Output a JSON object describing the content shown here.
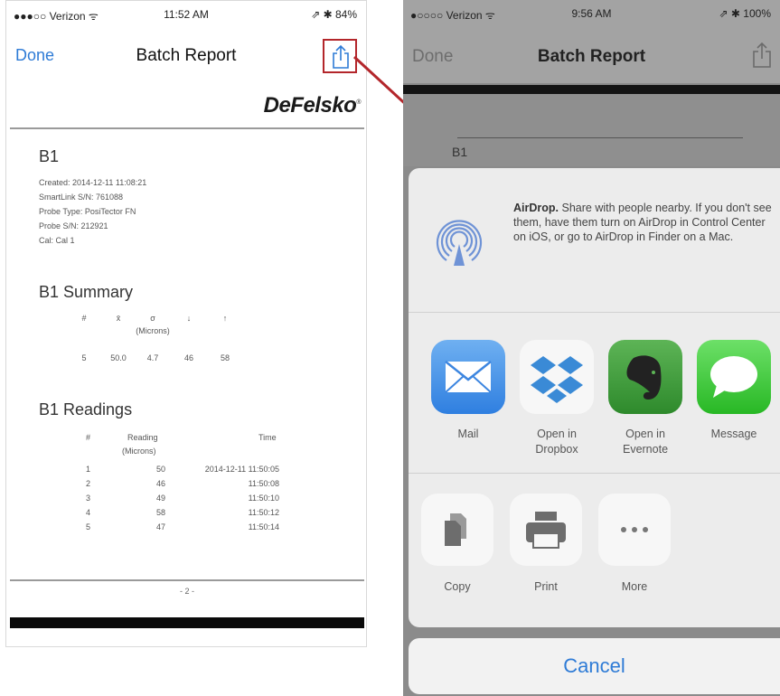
{
  "left": {
    "status": {
      "carrier": "●●●○○ Verizon ᯤ",
      "time": "11:52 AM",
      "right": "⇗ ✱ 84%"
    },
    "nav": {
      "done": "Done",
      "title": "Batch Report"
    },
    "doc": {
      "logo": "DeFelsko",
      "batch": "B1",
      "meta": [
        "Created: 2014-12-11 11:08:21",
        "SmartLink S/N: 761088",
        "Probe Type: PosiTector FN",
        "Probe S/N: 212921",
        "Cal: Cal 1"
      ],
      "summary_title": "B1 Summary",
      "summary_headers": [
        "#",
        "x̄",
        "σ",
        "↓",
        "↑"
      ],
      "summary_units": "(Microns)",
      "summary_values": [
        "5",
        "50.0",
        "4.7",
        "46",
        "58"
      ],
      "readings_title": "B1 Readings",
      "readings_headers": {
        "num": "#",
        "reading": "Reading",
        "units": "(Microns)",
        "time": "Time"
      },
      "readings": [
        {
          "n": "1",
          "value": "50",
          "time": "2014-12-11 11:50:05"
        },
        {
          "n": "2",
          "value": "46",
          "time": "11:50:08"
        },
        {
          "n": "3",
          "value": "49",
          "time": "11:50:10"
        },
        {
          "n": "4",
          "value": "58",
          "time": "11:50:12"
        },
        {
          "n": "5",
          "value": "47",
          "time": "11:50:14"
        }
      ],
      "page": "- 2 -"
    }
  },
  "right": {
    "status": {
      "carrier": "●○○○○ Verizon ᯤ",
      "time": "9:56 AM",
      "right": "⇗ ✱ 100%"
    },
    "nav": {
      "done": "Done",
      "title": "Batch Report"
    },
    "doc_peek": "B1",
    "airdrop": {
      "title": "AirDrop.",
      "text": "Share with people nearby. If you don't see them, have them turn on AirDrop in Control Center on iOS, or go to AirDrop in Finder on a Mac."
    },
    "apps": [
      {
        "label": "Mail",
        "icon": "mail-icon"
      },
      {
        "label": "Open in Dropbox",
        "icon": "dropbox-icon"
      },
      {
        "label": "Open in Evernote",
        "icon": "evernote-icon"
      },
      {
        "label": "Message",
        "icon": "message-icon"
      }
    ],
    "actions": [
      {
        "label": "Copy",
        "icon": "copy-icon"
      },
      {
        "label": "Print",
        "icon": "print-icon"
      },
      {
        "label": "More",
        "icon": "more-icon"
      }
    ],
    "cancel": "Cancel"
  },
  "colors": {
    "accent": "#2e7bd6",
    "highlight": "#b3262b",
    "mail": "#4a90e2",
    "evernote": "#3e9b3a",
    "message": "#3fc53b"
  }
}
